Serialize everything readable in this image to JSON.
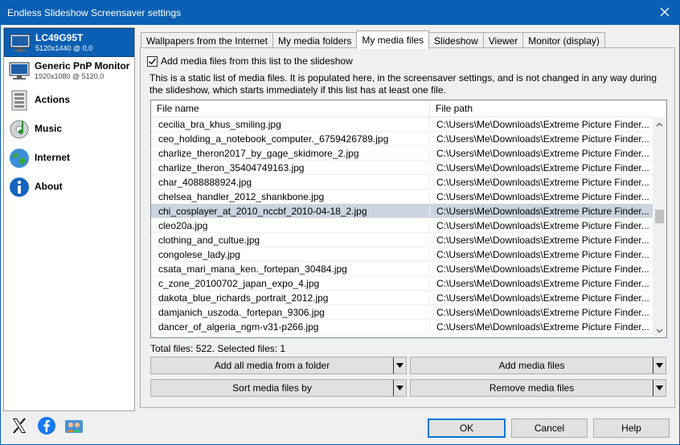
{
  "window": {
    "title": "Endless Slideshow Screensaver settings"
  },
  "sidebar": {
    "items": [
      {
        "name": "LC49G95T",
        "sub": "5120x1440 @ 0,0",
        "icon": "monitor-icon"
      },
      {
        "name": "Generic PnP Monitor",
        "sub": "1920x1080 @ 5120,0",
        "icon": "monitor-icon"
      },
      {
        "name": "Actions",
        "icon": "actions-icon"
      },
      {
        "name": "Music",
        "icon": "music-icon"
      },
      {
        "name": "Internet",
        "icon": "globe-icon"
      },
      {
        "name": "About",
        "icon": "info-icon"
      }
    ]
  },
  "tabs": [
    {
      "label": "Wallpapers from the Internet"
    },
    {
      "label": "My media folders"
    },
    {
      "label": "My media files"
    },
    {
      "label": "Slideshow"
    },
    {
      "label": "Viewer"
    },
    {
      "label": "Monitor (display)"
    }
  ],
  "panel": {
    "checkbox_label": "Add media files from this list to the slideshow",
    "description": "This is a static list of media files. It is populated here, in the screensaver settings, and is not changed in any way during the slideshow, which starts immediately if this list has at least one file.",
    "columns": {
      "file_name": "File name",
      "file_path": "File path"
    },
    "rows": [
      {
        "name": "cecilia_bra_khus_smiling.jpg",
        "path": "C:\\Users\\Me\\Downloads\\Extreme Picture Finder..."
      },
      {
        "name": "ceo_holding_a_notebook_computer._6759426789.jpg",
        "path": "C:\\Users\\Me\\Downloads\\Extreme Picture Finder..."
      },
      {
        "name": "charlize_theron2017_by_gage_skidmore_2.jpg",
        "path": "C:\\Users\\Me\\Downloads\\Extreme Picture Finder..."
      },
      {
        "name": "charlize_theron_35404749163.jpg",
        "path": "C:\\Users\\Me\\Downloads\\Extreme Picture Finder..."
      },
      {
        "name": "char_4088888924.jpg",
        "path": "C:\\Users\\Me\\Downloads\\Extreme Picture Finder..."
      },
      {
        "name": "chelsea_handler_2012_shankbone.jpg",
        "path": "C:\\Users\\Me\\Downloads\\Extreme Picture Finder..."
      },
      {
        "name": "chi_cosplayer_at_2010_nccbf_2010-04-18_2.jpg",
        "path": "C:\\Users\\Me\\Downloads\\Extreme Picture Finder..."
      },
      {
        "name": "cleo20a.jpg",
        "path": "C:\\Users\\Me\\Downloads\\Extreme Picture Finder..."
      },
      {
        "name": "clothing_and_cultue.jpg",
        "path": "C:\\Users\\Me\\Downloads\\Extreme Picture Finder..."
      },
      {
        "name": "congolese_lady.jpg",
        "path": "C:\\Users\\Me\\Downloads\\Extreme Picture Finder..."
      },
      {
        "name": "csata_mari_mana_ken._fortepan_30484.jpg",
        "path": "C:\\Users\\Me\\Downloads\\Extreme Picture Finder..."
      },
      {
        "name": "c_zone_20100702_japan_expo_4.jpg",
        "path": "C:\\Users\\Me\\Downloads\\Extreme Picture Finder..."
      },
      {
        "name": "dakota_blue_richards_portrait_2012.jpg",
        "path": "C:\\Users\\Me\\Downloads\\Extreme Picture Finder..."
      },
      {
        "name": "damjanich_uszoda._fortepan_9306.jpg",
        "path": "C:\\Users\\Me\\Downloads\\Extreme Picture Finder..."
      },
      {
        "name": "dancer_of_algeria_ngm-v31-p266.jpg",
        "path": "C:\\Users\\Me\\Downloads\\Extreme Picture Finder..."
      }
    ],
    "selected_row": "chi_cosplayer_at_2010_nccbf_2010-04-18_2.jpg",
    "totals": "Total files: 522. Selected files: 1",
    "buttons": {
      "add_folder": "Add all media from a folder",
      "add_files": "Add media files",
      "sort": "Sort media files by",
      "remove": "Remove media files"
    }
  },
  "footer": {
    "ok": "OK",
    "cancel": "Cancel",
    "help": "Help",
    "social_icons": [
      "x-icon",
      "facebook-icon",
      "users-icon"
    ]
  },
  "colors": {
    "accent": "#0a5fb4",
    "selected_row": "#cbd5e1"
  }
}
